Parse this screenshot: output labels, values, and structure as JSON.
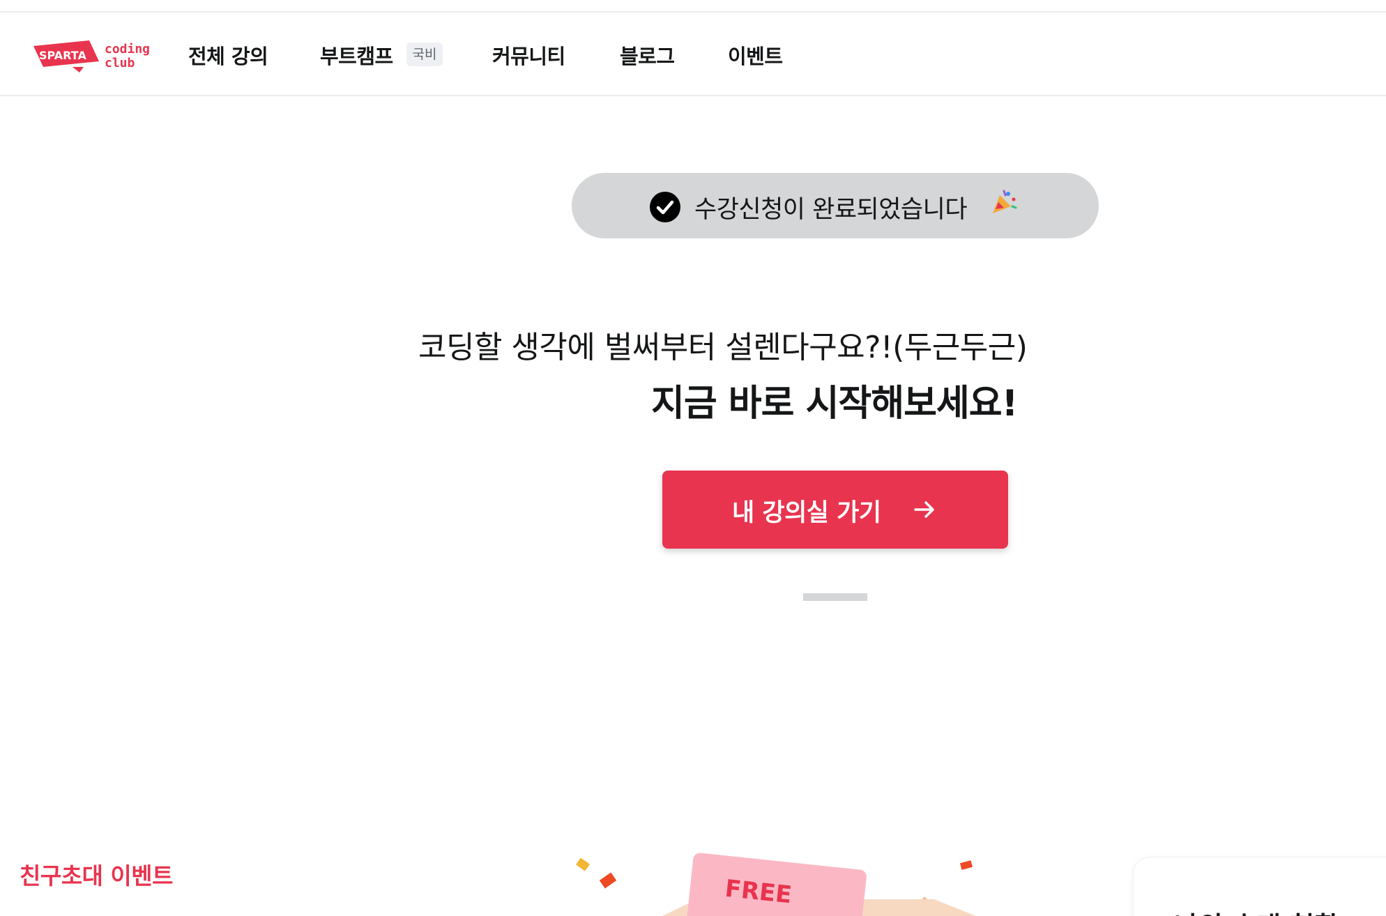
{
  "header": {
    "logo": {
      "text": "SPARTA",
      "sub_line1": "coding",
      "sub_line2": "club"
    },
    "nav": [
      {
        "label": "전체 강의"
      },
      {
        "label": "부트캠프",
        "badge": "국비"
      },
      {
        "label": "커뮤니티"
      },
      {
        "label": "블로그"
      },
      {
        "label": "이벤트"
      }
    ]
  },
  "toast": {
    "text": "수강신청이 완료되었습니다",
    "icon": "check-circle-icon",
    "emoji": "party-popper-icon"
  },
  "hero": {
    "subtitle": "코딩할 생각에 벌써부터 설렌다구요?!(두근두근)",
    "title": "지금 바로 시작해보세요!"
  },
  "cta": {
    "label": "내 강의실 가기",
    "icon": "arrow-right-icon"
  },
  "event": {
    "label": "친구초대 이벤트",
    "ticket_text": "FREE",
    "status_card_title": "나의 초대 현황"
  },
  "colors": {
    "brand": "#e8344e",
    "text": "#141617",
    "toast_bg": "#d5d6d7"
  }
}
